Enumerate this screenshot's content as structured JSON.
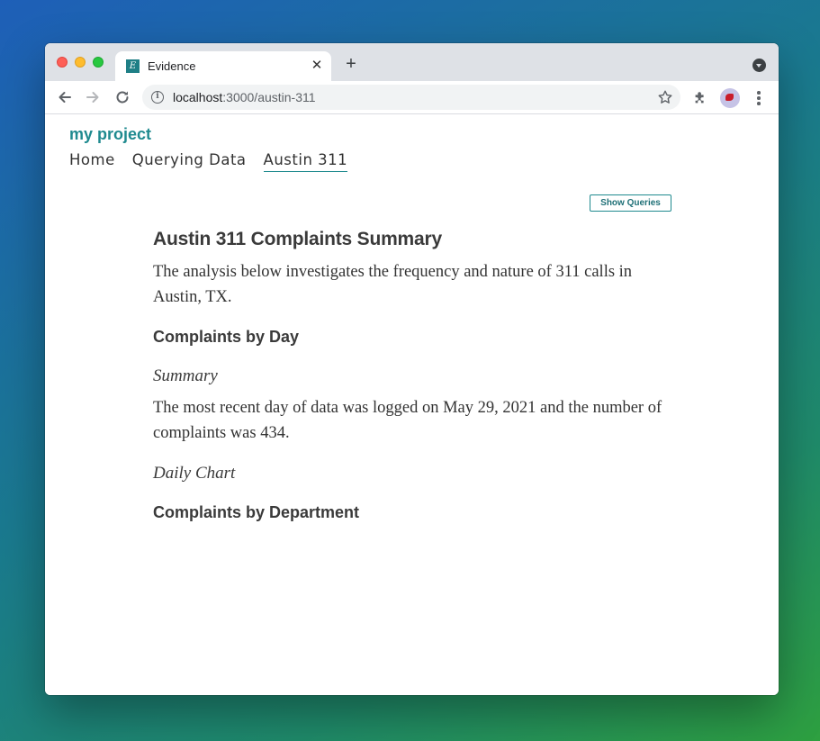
{
  "browser": {
    "tab_title": "Evidence",
    "tab_favicon_letter": "E",
    "tab_close": "✕",
    "new_tab": "+",
    "url_host": "localhost",
    "url_rest": ":3000/austin-311"
  },
  "site": {
    "brand": "my project",
    "nav": [
      "Home",
      "Querying Data",
      "Austin 311"
    ],
    "active_nav": "Austin 311",
    "show_queries_label": "Show Queries"
  },
  "article": {
    "title": "Austin 311 Complaints Summary",
    "intro": "The analysis below investigates the frequency and nature of 311 calls in Austin, TX.",
    "section1": "Complaints by Day",
    "summary_heading": "Summary",
    "summary_text": "The most recent day of data was logged on May 29, 2021 and the number of complaints was 434.",
    "chart_heading": "Daily Chart",
    "section2": "Complaints by Department"
  },
  "colors": {
    "accent": "#1f8a8f",
    "heading": "#3a3a3a",
    "text": "#333333"
  }
}
